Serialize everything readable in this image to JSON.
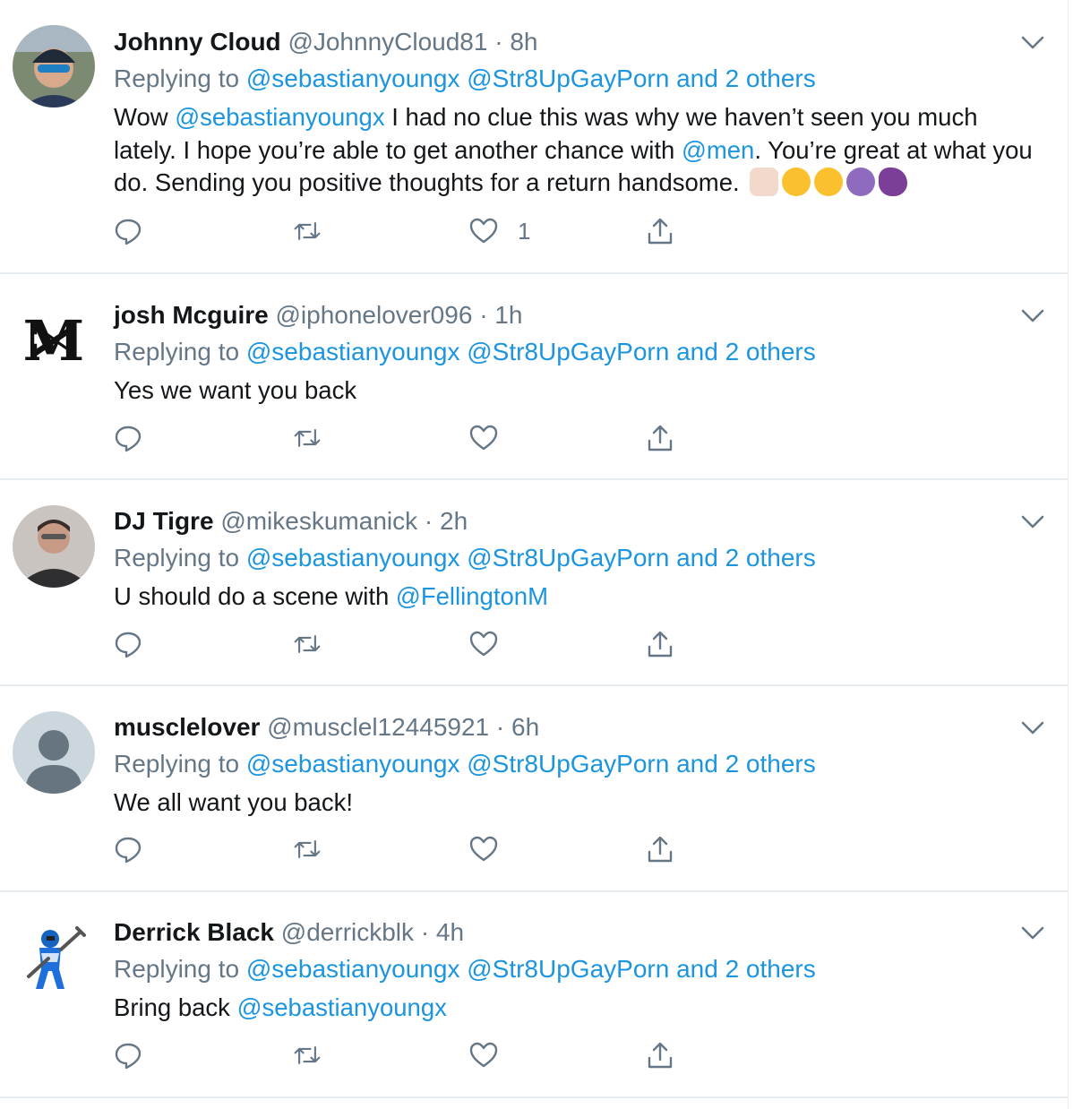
{
  "tweets": [
    {
      "name": "Johnny Cloud",
      "handle": "@JohnnyCloud81",
      "dot": "·",
      "time": "8h",
      "replying_prefix": "Replying to",
      "replying_to": "@sebastianyoungx @Str8UpGayPorn and 2 others",
      "body_parts": [
        "Wow ",
        "@sebastianyoungx",
        " I had no clue this was why we haven’t seen you much lately. I hope you’re able to get another chance with ",
        "@men",
        ". You’re great at what you do. Sending you positive thoughts for a return handsome. "
      ],
      "emojis": [
        "thumbs-up",
        "grinning-face",
        "winking-face",
        "smiling-devil",
        "eggplant"
      ],
      "like_count": "1",
      "avatar": "photo-man-sunglasses"
    },
    {
      "name": "josh Mcguire",
      "handle": "@iphonelover096",
      "dot": "·",
      "time": "1h",
      "replying_prefix": "Replying to",
      "replying_to": "@sebastianyoungx @Str8UpGayPorn and 2 others",
      "body": "Yes we want you back",
      "like_count": "",
      "avatar": "monogram-logo"
    },
    {
      "name": "DJ Tigre",
      "handle": "@mikeskumanick",
      "dot": "·",
      "time": "2h",
      "replying_prefix": "Replying to",
      "replying_to": "@sebastianyoungx @Str8UpGayPorn and 2 others",
      "body_text": "U should do a scene with ",
      "body_mention": "@FellingtonM",
      "like_count": "",
      "avatar": "photo-man-glasses"
    },
    {
      "name": "musclelover",
      "handle": "@musclel12445921",
      "dot": "·",
      "time": "6h",
      "replying_prefix": "Replying to",
      "replying_to": "@sebastianyoungx @Str8UpGayPorn and 2 others",
      "body": "We all want you back!",
      "like_count": "",
      "avatar": "default-profile"
    },
    {
      "name": "Derrick Black",
      "handle": "@derrickblk",
      "dot": "·",
      "time": "4h",
      "replying_prefix": "Replying to",
      "replying_to": "@sebastianyoungx @Str8UpGayPorn and 2 others",
      "body_text": "Bring back ",
      "body_mention": "@sebastianyoungx",
      "like_count": "",
      "avatar": "blue-ranger-illustration"
    }
  ],
  "colors": {
    "link": "#1b95e0",
    "secondary": "#657786",
    "text": "#14171a",
    "border": "#e6ecf0"
  }
}
